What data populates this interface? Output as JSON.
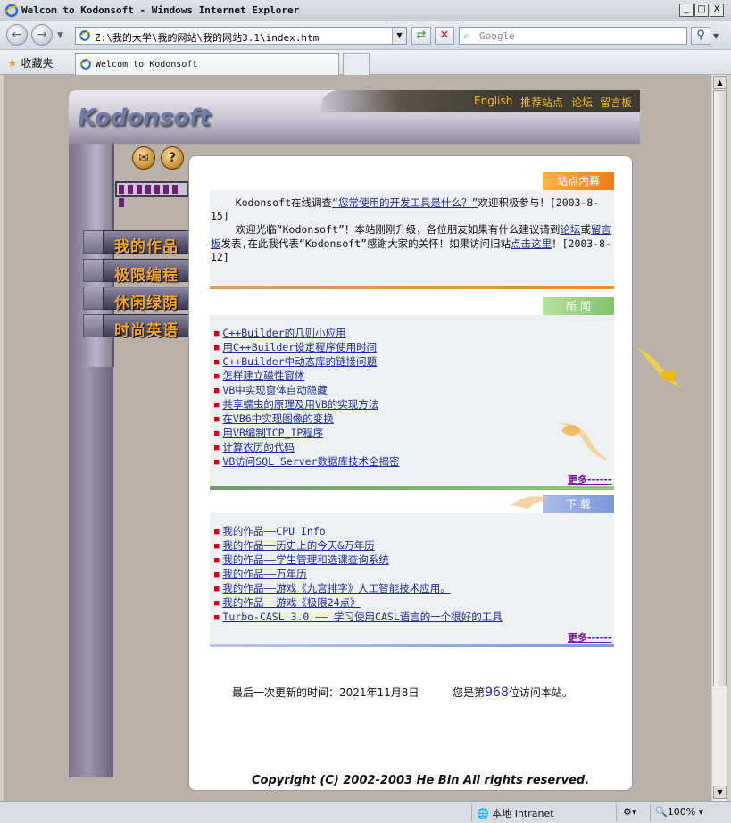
{
  "window": {
    "title": "Welcom to Kodonsoft - Windows Internet Explorer",
    "min": "_",
    "max": "□",
    "close": "X"
  },
  "nav": {
    "address": "Z:\\我的大学\\我的网站\\我的网站3.1\\index.htm",
    "search_placeholder": "Google"
  },
  "favorites": {
    "label": "收藏夹",
    "tab_title": "Welcom to Kodonsoft"
  },
  "site": {
    "logo": "Kodonsoft",
    "topnav": [
      "English",
      "推荐站点",
      "论坛",
      "留言板"
    ],
    "menu": [
      "我的作品",
      "极限编程",
      "休闲绿荫",
      "时尚英语"
    ],
    "icons": {
      "mail": "✉",
      "help": "?"
    }
  },
  "notice": {
    "head": "站点内幕",
    "p1_pre": "    Kodonsoft在线调查",
    "p1_link": "“您常使用的开发工具是什么？”",
    "p1_post": "欢迎积极参与！[2003-8-15]",
    "p2_pre": "    欢迎光临“Kodonsoft”！本站刚刚升级，各位朋友如果有什么建议请到",
    "p2_link1": "论坛",
    "p2_mid1": "或",
    "p2_link2": "留言板",
    "p2_mid2": "发表,在此我代表“Kodonsoft”感谢大家的关怀！如果访问旧站",
    "p2_link3": "点击这里",
    "p2_post": "！[2003-8-12]"
  },
  "news": {
    "head": "新  闻",
    "items": [
      "C++Builder的几则小应用",
      "用C++Builder设定程序使用时间",
      "C++Builder中动态库的链接问题",
      "怎样建立磁性窗体",
      "VB中实现窗体自动隐藏",
      "共享蠕虫的原理及用VB的实现方法",
      "在VB6中实现图像的变换",
      "用VB编制TCP_IP程序",
      "计算农历的代码",
      "VB访问SQL Server数据库技术全揭密"
    ],
    "more": "更多------"
  },
  "downloads": {
    "head": "下  载",
    "items": [
      "我的作品——CPU Info",
      "我的作品——历史上的今天&万年历",
      "我的作品——学生管理和选课查询系统",
      "我的作品——万年历",
      "我的作品——游戏《九宫排字》人工智能技术应用。",
      "我的作品——游戏《极限24点》",
      "Turbo-CASL 3.0 —— 学习使用CASL语言的一个很好的工具"
    ],
    "more": "更多------"
  },
  "footer": {
    "updated": "最后一次更新的时间：2021年11月8日",
    "visit_pre": "您是第",
    "visit_count": "968",
    "visit_post": "位访问本站。",
    "copyright": "Copyright (C) 2002-2003 He Bin  All rights reserved."
  },
  "status": {
    "zone": "本地 Intranet",
    "zoom": "100%"
  },
  "colors": {
    "accent_orange": "#f08a2a",
    "accent_green": "#8ccf6e",
    "accent_blue": "#7f97d8",
    "link": "#1a2e9a",
    "bullet": "#d1001b"
  }
}
